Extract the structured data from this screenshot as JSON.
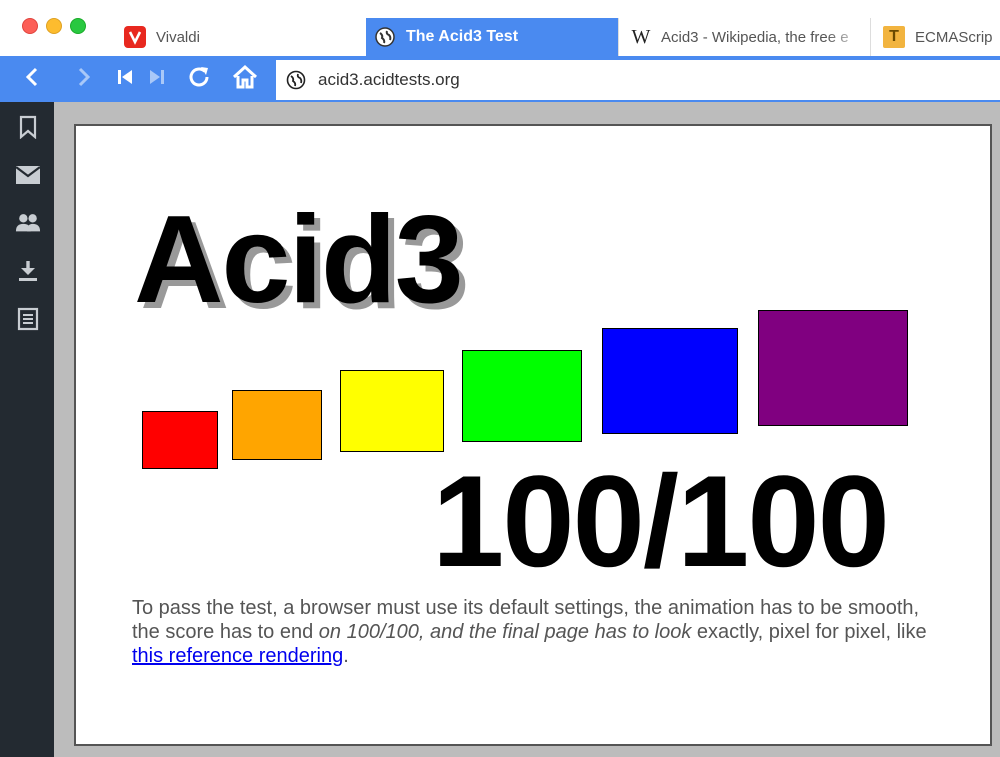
{
  "tabs": [
    {
      "title": "Vivaldi",
      "icon": "vivaldi-icon",
      "active": false
    },
    {
      "title": "The Acid3 Test",
      "icon": "globe-icon",
      "active": true
    },
    {
      "title": "Acid3 - Wikipedia, the free e",
      "icon": "wikipedia-icon",
      "active": false
    },
    {
      "title": "ECMAScrip",
      "icon": "ecmascript-icon",
      "active": false
    }
  ],
  "favicon_letters": {
    "wikipedia": "W",
    "ecmascript": "T"
  },
  "address_bar": {
    "url": "acid3.acidtests.org"
  },
  "nav_icons": [
    "back-icon",
    "forward-icon",
    "rewind-icon",
    "fast-forward-icon",
    "reload-icon",
    "home-icon"
  ],
  "panel_icons": [
    "bookmarks-icon",
    "mail-icon",
    "contacts-icon",
    "downloads-icon",
    "notes-icon"
  ],
  "page": {
    "title": "Acid3",
    "score": "100/100",
    "description_part1": "To pass the test, a browser must use its default settings, the animation has to be smooth, the score has to end ",
    "description_part2": "on 100/100, and the final page has to look",
    "description_part3": " exactly, pixel for pixel, like ",
    "description_link": "this reference rendering",
    "description_end": "."
  },
  "colors": {
    "accent": "#4a8af0",
    "panel": "#232a31",
    "boxes": [
      "#ff0000",
      "#ffa500",
      "#ffff00",
      "#00ff00",
      "#0000ff",
      "#800080"
    ]
  }
}
